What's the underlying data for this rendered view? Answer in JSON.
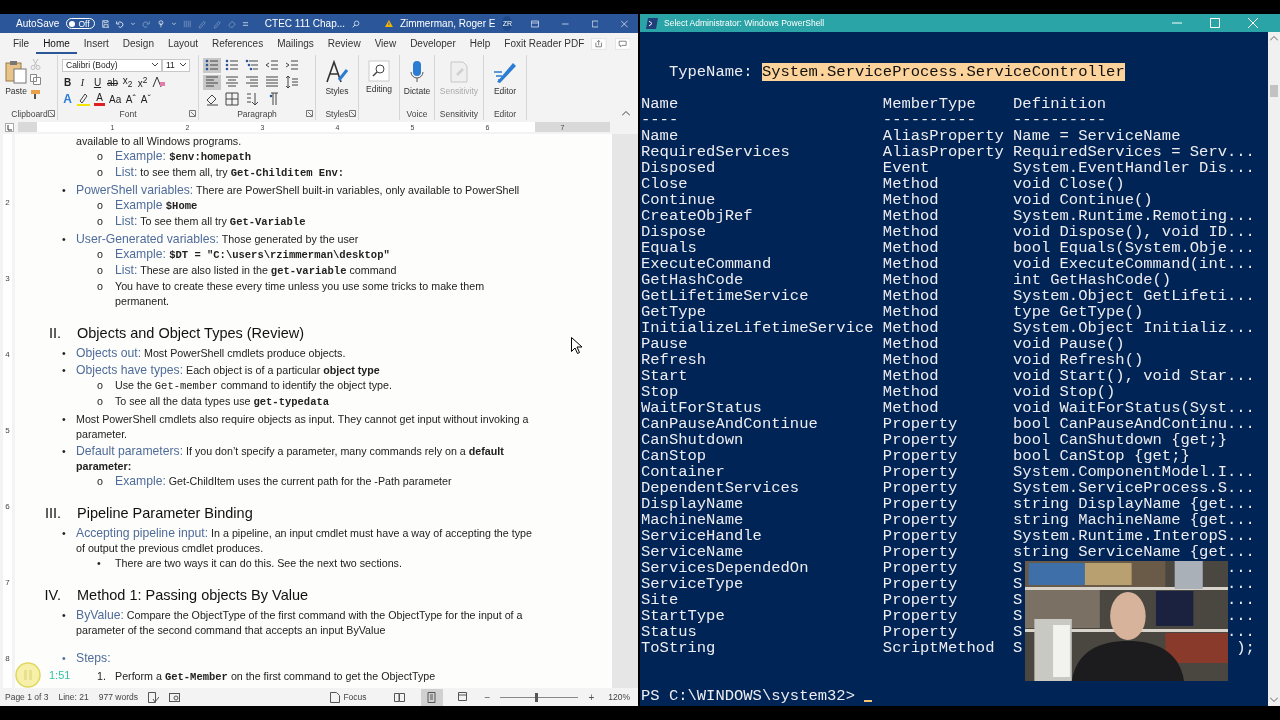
{
  "word": {
    "title_bar": {
      "autosave_label": "AutoSave",
      "autosave": {
        "on": false,
        "label": "Off"
      },
      "document_title": "CTEC 111 Chap...",
      "user_name": "Zimmerman, Roger E",
      "user_initials": "ZR"
    },
    "tabs": [
      {
        "label": "File",
        "selected": false
      },
      {
        "label": "Home",
        "selected": true
      },
      {
        "label": "Insert",
        "selected": false
      },
      {
        "label": "Design",
        "selected": false
      },
      {
        "label": "Layout",
        "selected": false
      },
      {
        "label": "References",
        "selected": false
      },
      {
        "label": "Mailings",
        "selected": false
      },
      {
        "label": "Review",
        "selected": false
      },
      {
        "label": "View",
        "selected": false
      },
      {
        "label": "Developer",
        "selected": false
      },
      {
        "label": "Help",
        "selected": false
      },
      {
        "label": "Foxit Reader PDF",
        "selected": false
      }
    ],
    "ribbon": {
      "clipboard": {
        "paste_label": "Paste",
        "group_label": "Clipboard"
      },
      "font": {
        "name": "Calibri (Body)",
        "size": "11",
        "format_buttons": [
          {
            "kind": "bold",
            "label": "B"
          },
          {
            "kind": "italic",
            "label": "I"
          },
          {
            "kind": "underline",
            "label": "U"
          },
          {
            "kind": "strike",
            "label": "ab"
          },
          {
            "kind": "plain",
            "label": "x$_{2}$"
          },
          {
            "kind": "plain",
            "label": "x$^{2}$"
          }
        ],
        "effects_button": "A",
        "color_button": "A",
        "case_button": "Aa",
        "grow_button": "Aˆ",
        "shrink_button": "Aˇ",
        "group_label": "Font"
      },
      "paragraph": {
        "group_label": "Paragraph",
        "rows": [
          [
            {
              "kind": "bullets",
              "selected": true
            },
            {
              "kind": "numbering",
              "selected": false
            },
            {
              "kind": "multilevel",
              "selected": false
            },
            {
              "kind": "outdent",
              "selected": false
            },
            {
              "kind": "indent",
              "selected": false
            }
          ],
          [
            {
              "kind": "align-left",
              "selected": true
            },
            {
              "kind": "center",
              "selected": false
            },
            {
              "kind": "align-right",
              "selected": false
            },
            {
              "kind": "justify",
              "selected": false
            },
            {
              "kind": "line-spacing",
              "selected": false
            }
          ],
          [
            {
              "kind": "shading",
              "selected": false
            },
            {
              "kind": "borders",
              "selected": false
            },
            {
              "kind": "sort",
              "selected": false
            },
            {
              "kind": "show-marks",
              "selected": false
            }
          ]
        ]
      },
      "styles": {
        "label": "Styles",
        "group_label": "Styles"
      },
      "editing": {
        "label": "Editing"
      },
      "voice": {
        "label": "Dictate",
        "group_label": "Voice"
      },
      "sensitivity": {
        "label": "Sensitivity",
        "group_label": "Sensitivity",
        "disabled": true
      },
      "editor": {
        "label": "Editor",
        "group_label": "Editor"
      }
    },
    "ruler_marks": [
      "1",
      "2",
      "3",
      "4",
      "5",
      "6",
      "7"
    ],
    "vertical_ruler_marks": [
      "2",
      "3",
      "4",
      "5",
      "6",
      "7",
      "8"
    ],
    "document": {
      "blocks": [
        {
          "kind": "para",
          "parts": [
            {
              "kind": "text",
              "text": "available to all Windows programs."
            }
          ]
        },
        {
          "kind": "sub",
          "marker": "o",
          "parts": [
            {
              "kind": "label",
              "text": "Example: "
            },
            {
              "kind": "code",
              "text": "$env:homepath"
            }
          ]
        },
        {
          "kind": "sub",
          "marker": "o",
          "parts": [
            {
              "kind": "label",
              "text": "List:"
            },
            {
              "kind": "text",
              "text": " to see them all, try "
            },
            {
              "kind": "code",
              "text": "Get-Childitem Env:"
            }
          ]
        },
        {
          "kind": "bullet",
          "marker": "•",
          "parts": [
            {
              "kind": "label",
              "text": "PowerShell variables:"
            },
            {
              "kind": "text",
              "text": " There are PowerShell built-in variables, only available to PowerShell"
            }
          ]
        },
        {
          "kind": "sub",
          "marker": "o",
          "parts": [
            {
              "kind": "label",
              "text": "Example "
            },
            {
              "kind": "code",
              "text": "$Home"
            }
          ]
        },
        {
          "kind": "sub",
          "marker": "o",
          "parts": [
            {
              "kind": "label",
              "text": "List:"
            },
            {
              "kind": "text",
              "text": " To see them all try "
            },
            {
              "kind": "code",
              "text": "Get-Variable"
            }
          ]
        },
        {
          "kind": "bullet",
          "marker": "•",
          "parts": [
            {
              "kind": "label",
              "text": "User-Generated variables:"
            },
            {
              "kind": "text",
              "text": " Those generated by the user"
            }
          ]
        },
        {
          "kind": "sub",
          "marker": "o",
          "parts": [
            {
              "kind": "label",
              "text": "Example: "
            },
            {
              "kind": "code",
              "text": "$DT = \"C:\\users\\rzimmerman\\desktop\""
            }
          ]
        },
        {
          "kind": "sub",
          "marker": "o",
          "parts": [
            {
              "kind": "label",
              "text": "List:"
            },
            {
              "kind": "text",
              "text": " These are also listed in the "
            },
            {
              "kind": "code",
              "text": "get-variable"
            },
            {
              "kind": "text",
              "text": " command"
            }
          ]
        },
        {
          "kind": "sub",
          "marker": "o",
          "parts": [
            {
              "kind": "text",
              "text": "You have to create these every time unless you use some tricks to make them permanent."
            }
          ]
        },
        {
          "kind": "heading",
          "marker": "II.",
          "parts": [
            {
              "kind": "text",
              "text": "Objects and Object Types (Review)"
            }
          ]
        },
        {
          "kind": "bullet",
          "marker": "•",
          "parts": [
            {
              "kind": "label",
              "text": "Objects out:"
            },
            {
              "kind": "text",
              "text": " Most PowerShell cmdlets produce objects."
            }
          ]
        },
        {
          "kind": "bullet",
          "marker": "•",
          "parts": [
            {
              "kind": "label",
              "text": "Objects have types:"
            },
            {
              "kind": "text",
              "text": " Each object is of a particular "
            },
            {
              "kind": "bold",
              "text": "object type"
            }
          ]
        },
        {
          "kind": "sub",
          "marker": "o",
          "parts": [
            {
              "kind": "text",
              "text": "Use the "
            },
            {
              "kind": "mono",
              "text": "Get-member"
            },
            {
              "kind": "text",
              "text": " command to identify the object type."
            }
          ]
        },
        {
          "kind": "sub",
          "marker": "o",
          "parts": [
            {
              "kind": "text",
              "text": "To see all the data types use "
            },
            {
              "kind": "code",
              "text": "get-typedata"
            }
          ]
        },
        {
          "kind": "bullet",
          "marker": "•",
          "parts": [
            {
              "kind": "text",
              "text": "Most PowerShell cmdlets also require objects as input. They cannot get input without invoking a parameter."
            }
          ]
        },
        {
          "kind": "bullet",
          "marker": "•",
          "parts": [
            {
              "kind": "label",
              "text": "Default parameters:"
            },
            {
              "kind": "text",
              "text": " If you don’t specify a parameter, many commands rely on a "
            },
            {
              "kind": "bold",
              "text": "default parameter:"
            }
          ]
        },
        {
          "kind": "sub",
          "marker": "o",
          "parts": [
            {
              "kind": "label",
              "text": "Example:"
            },
            {
              "kind": "text",
              "text": " Get-ChildItem uses the current path for the -Path parameter"
            }
          ]
        },
        {
          "kind": "heading",
          "marker": "III.",
          "parts": [
            {
              "kind": "text",
              "text": "Pipeline Parameter Binding"
            }
          ]
        },
        {
          "kind": "bullet",
          "marker": "•",
          "parts": [
            {
              "kind": "label",
              "text": "Accepting pipeline input:"
            },
            {
              "kind": "text",
              "text": " In a pipeline, an input cmdlet must have a way of accepting the type of output the previous cmdlet produces."
            }
          ]
        },
        {
          "kind": "subdot",
          "marker": "•",
          "parts": [
            {
              "kind": "text",
              "text": "There are two ways it can do this. See the next two sections."
            }
          ]
        },
        {
          "kind": "heading",
          "marker": "IV.",
          "parts": [
            {
              "kind": "text",
              "text": "Method 1: Passing objects By Value"
            }
          ]
        },
        {
          "kind": "bullet",
          "marker": "•",
          "parts": [
            {
              "kind": "label",
              "text": "ByValue:"
            },
            {
              "kind": "text",
              "text": " Compare the ObjectType of the first command with the ObjectType for the input of a parameter of the second command that accepts an input ByValue"
            }
          ]
        },
        {
          "kind": "step",
          "marker": "•",
          "parts": [
            {
              "kind": "label",
              "text": "Steps:"
            }
          ]
        },
        {
          "kind": "numbered",
          "marker": "1.",
          "parts": [
            {
              "kind": "text",
              "text": "Perform a "
            },
            {
              "kind": "code",
              "text": "Get-Member"
            },
            {
              "kind": "text",
              "text": " on the first command to get the ObjectType"
            }
          ]
        }
      ]
    },
    "video_overlay": {
      "time": "1:51"
    },
    "status_bar": {
      "page": "Page 1 of 3",
      "line": "Line: 21",
      "words": "977 words",
      "focus": "Focus",
      "views": [
        {
          "kind": "read",
          "selected": false
        },
        {
          "kind": "print",
          "selected": true
        },
        {
          "kind": "web",
          "selected": false
        }
      ],
      "zoom_out": "−",
      "zoom_in": "+",
      "zoom": {
        "level": 0.45,
        "label": "120%"
      }
    }
  },
  "powershell": {
    "title": "Select Administrator: Windows PowerShell",
    "type_label": "TypeName:",
    "type_name": {
      "text": "System.ServiceProcess.ServiceController",
      "selected": true
    },
    "columns": [
      "Name",
      "MemberType",
      "Definition"
    ],
    "header_rule": [
      "----",
      "----------",
      "----------"
    ],
    "members": [
      {
        "name": "Name",
        "member_type": "AliasProperty",
        "definition": "Name = ServiceName"
      },
      {
        "name": "RequiredServices",
        "member_type": "AliasProperty",
        "definition": "RequiredServices = Serv..."
      },
      {
        "name": "Disposed",
        "member_type": "Event",
        "definition": "System.EventHandler Dis..."
      },
      {
        "name": "Close",
        "member_type": "Method",
        "definition": "void Close()"
      },
      {
        "name": "Continue",
        "member_type": "Method",
        "definition": "void Continue()"
      },
      {
        "name": "CreateObjRef",
        "member_type": "Method",
        "definition": "System.Runtime.Remoting..."
      },
      {
        "name": "Dispose",
        "member_type": "Method",
        "definition": "void Dispose(), void ID..."
      },
      {
        "name": "Equals",
        "member_type": "Method",
        "definition": "bool Equals(System.Obje..."
      },
      {
        "name": "ExecuteCommand",
        "member_type": "Method",
        "definition": "void ExecuteCommand(int..."
      },
      {
        "name": "GetHashCode",
        "member_type": "Method",
        "definition": "int GetHashCode()"
      },
      {
        "name": "GetLifetimeService",
        "member_type": "Method",
        "definition": "System.Object GetLifeti..."
      },
      {
        "name": "GetType",
        "member_type": "Method",
        "definition": "type GetType()"
      },
      {
        "name": "InitializeLifetimeService",
        "member_type": "Method",
        "definition": "System.Object Initializ..."
      },
      {
        "name": "Pause",
        "member_type": "Method",
        "definition": "void Pause()"
      },
      {
        "name": "Refresh",
        "member_type": "Method",
        "definition": "void Refresh()"
      },
      {
        "name": "Start",
        "member_type": "Method",
        "definition": "void Start(), void Star..."
      },
      {
        "name": "Stop",
        "member_type": "Method",
        "definition": "void Stop()"
      },
      {
        "name": "WaitForStatus",
        "member_type": "Method",
        "definition": "void WaitForStatus(Syst..."
      },
      {
        "name": "CanPauseAndContinue",
        "member_type": "Property",
        "definition": "bool CanPauseAndContinu..."
      },
      {
        "name": "CanShutdown",
        "member_type": "Property",
        "definition": "bool CanShutdown {get;}"
      },
      {
        "name": "CanStop",
        "member_type": "Property",
        "definition": "bool CanStop {get;}"
      },
      {
        "name": "Container",
        "member_type": "Property",
        "definition": "System.ComponentModel.I..."
      },
      {
        "name": "DependentServices",
        "member_type": "Property",
        "definition": "System.ServiceProcess.S..."
      },
      {
        "name": "DisplayName",
        "member_type": "Property",
        "definition": "string DisplayName {get..."
      },
      {
        "name": "MachineName",
        "member_type": "Property",
        "definition": "string MachineName {get..."
      },
      {
        "name": "ServiceHandle",
        "member_type": "Property",
        "definition": "System.Runtime.InteropS..."
      },
      {
        "name": "ServiceName",
        "member_type": "Property",
        "definition": "string ServiceName {get..."
      },
      {
        "name": "ServicesDependedOn",
        "member_type": "Property",
        "definition": "S",
        "definition_tail": "..."
      },
      {
        "name": "ServiceType",
        "member_type": "Property",
        "definition": "S",
        "definition_tail": "..."
      },
      {
        "name": "Site",
        "member_type": "Property",
        "definition": "S",
        "definition_tail": "..."
      },
      {
        "name": "StartType",
        "member_type": "Property",
        "definition": "S",
        "definition_tail": "..."
      },
      {
        "name": "Status",
        "member_type": "Property",
        "definition": "S",
        "definition_tail": "..."
      },
      {
        "name": "ToString",
        "member_type": "ScriptMethod",
        "definition": "S",
        "definition_tail": ");"
      }
    ],
    "prompt": "PS C:\\WINDOWS\\system32>",
    "webcam": {
      "kind": "picture"
    }
  }
}
